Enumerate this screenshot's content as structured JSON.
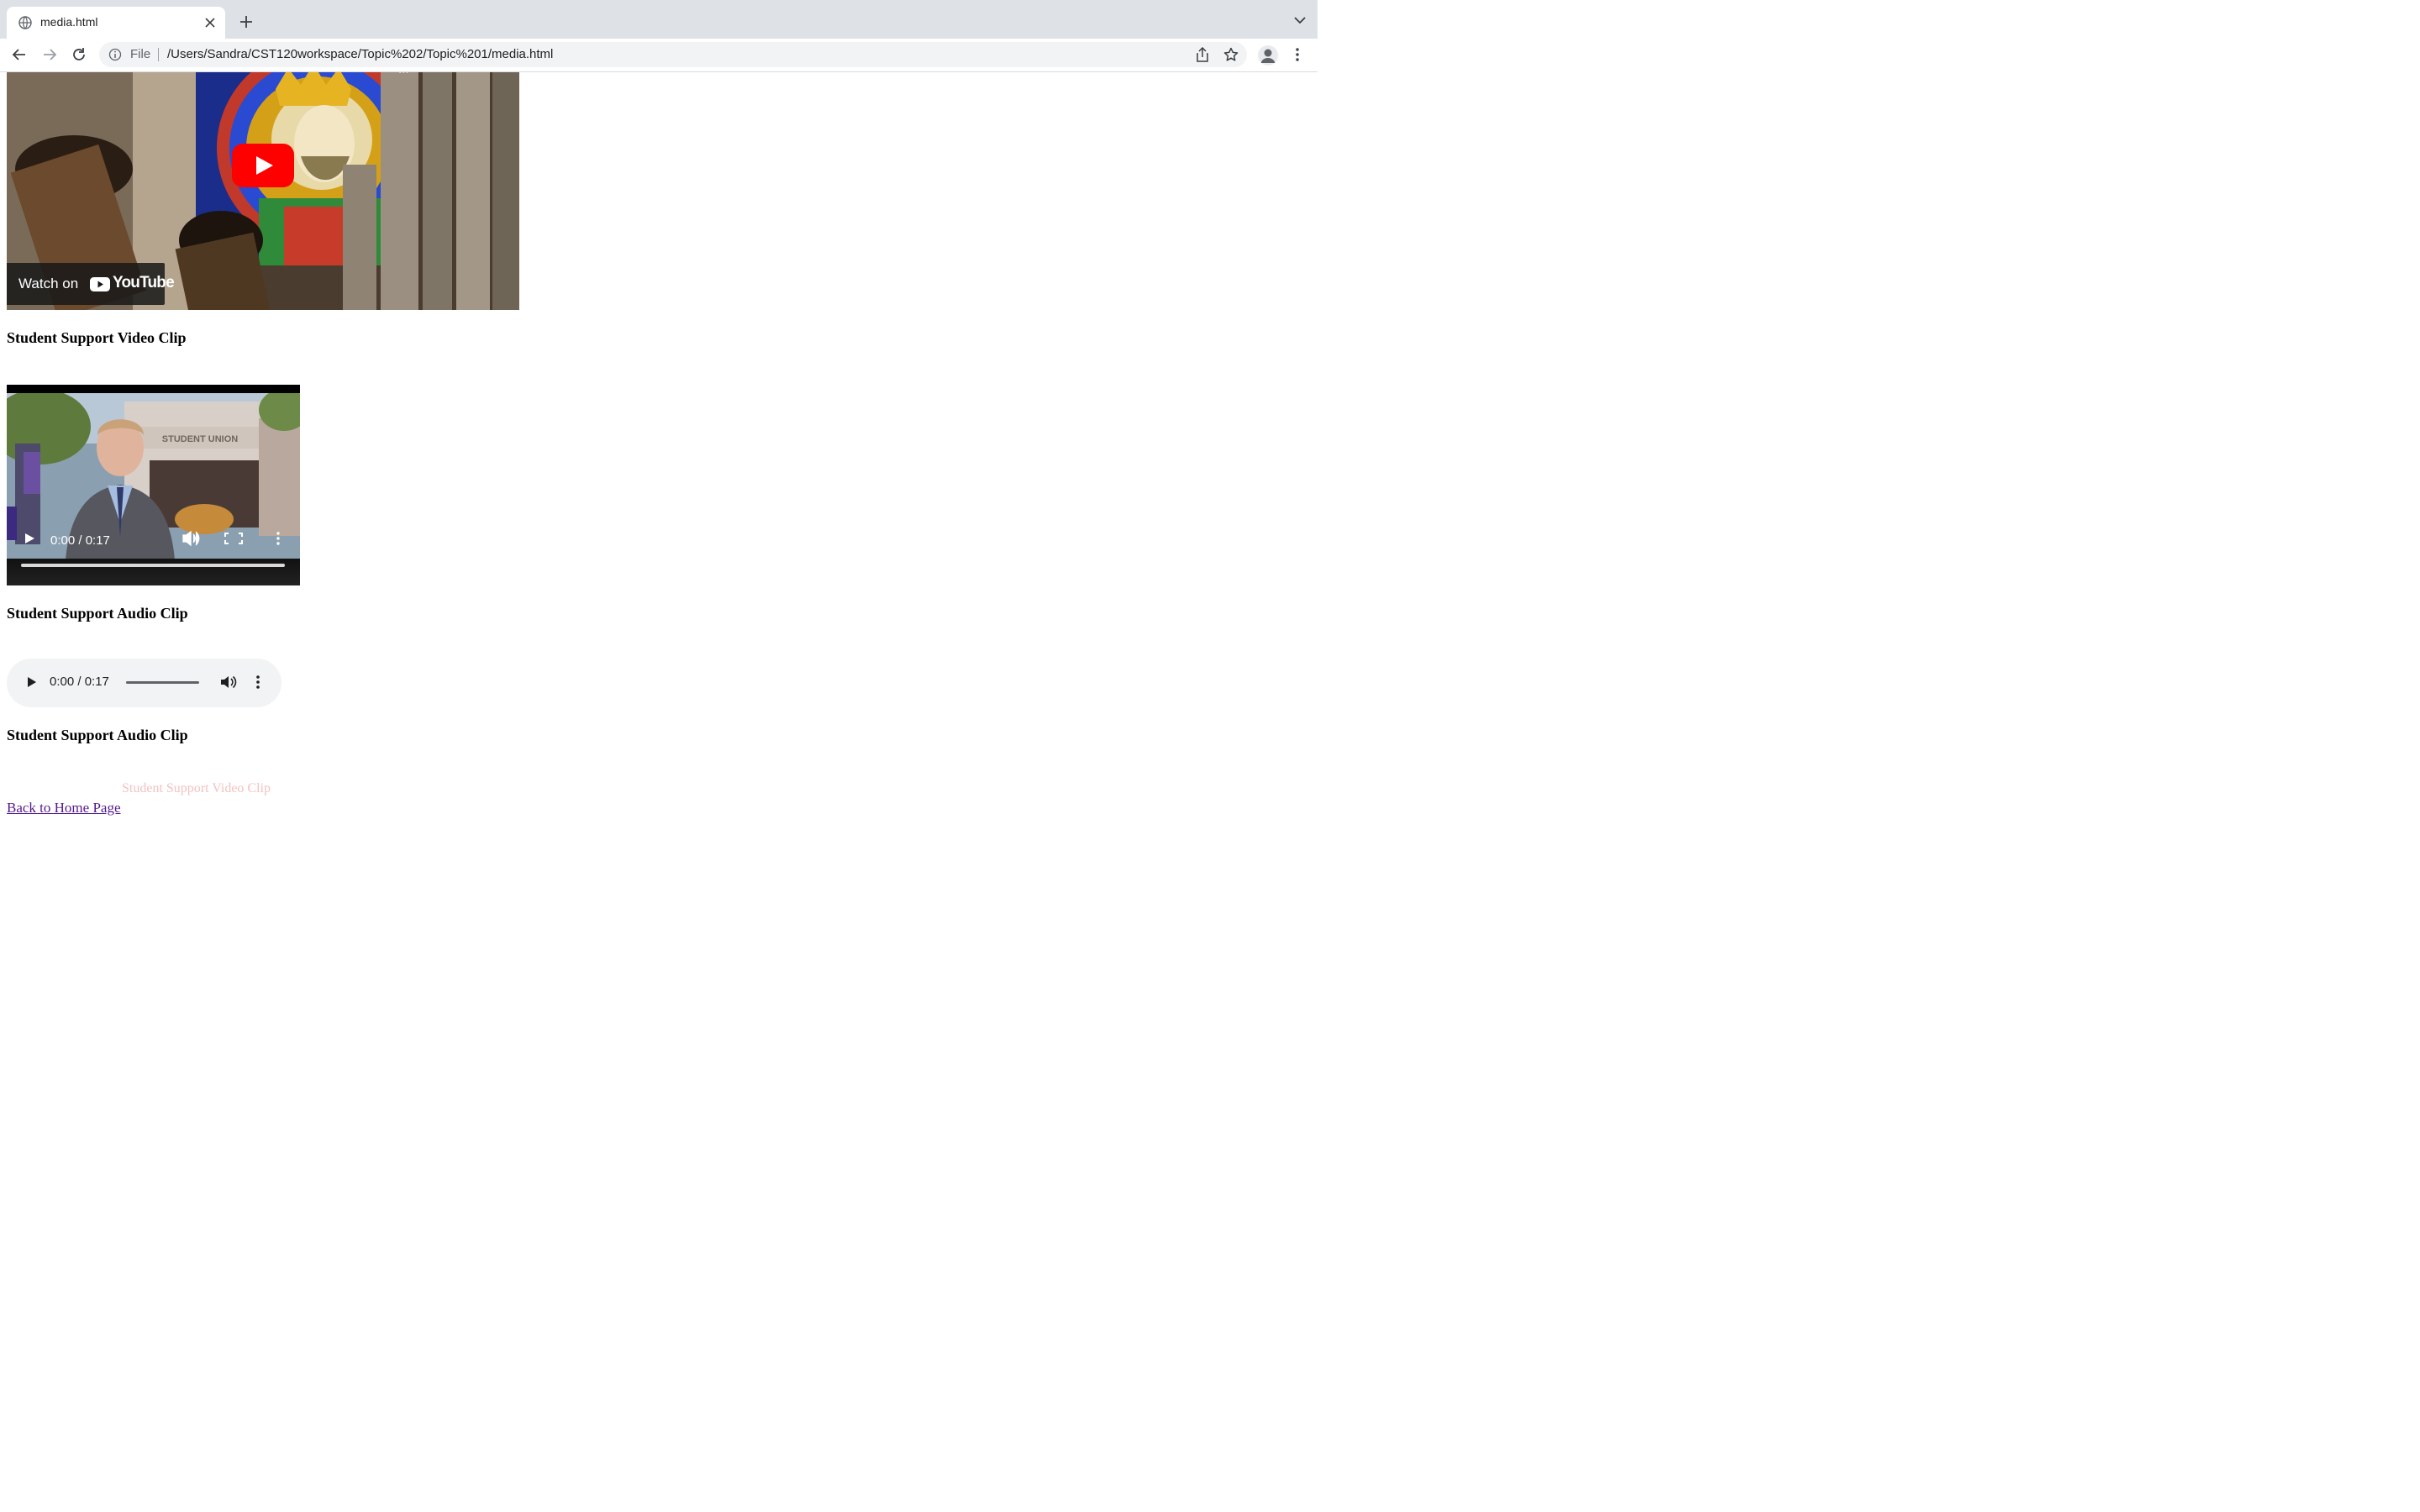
{
  "browser": {
    "tab_title": "media.html",
    "address_scheme": "File",
    "address_url": "/Users/Sandra/CST120workspace/Topic%202/Topic%201/media.html"
  },
  "youtube_embed": {
    "overlay_top_text": "...",
    "watch_on_label": "Watch on",
    "youtube_wordmark": "YouTube"
  },
  "sections": {
    "video_heading": "Student Support Video Clip",
    "audio_heading_1": "Student Support Audio Clip",
    "audio_heading_2": "Student Support Audio Clip"
  },
  "video_player": {
    "time": "0:00 / 0:17",
    "progress_fraction": 0.0,
    "sign_text": "STUDENT UNION"
  },
  "audio_player": {
    "time": "0:00 / 0:17",
    "progress_fraction": 0.0
  },
  "footer": {
    "ghost_text": "Student Support Video Clip",
    "back_link": "Back to Home Page"
  },
  "colors": {
    "youtube_red": "#ff0000",
    "visited_link": "#551a8b",
    "tabstrip_bg": "#dee1e6"
  }
}
